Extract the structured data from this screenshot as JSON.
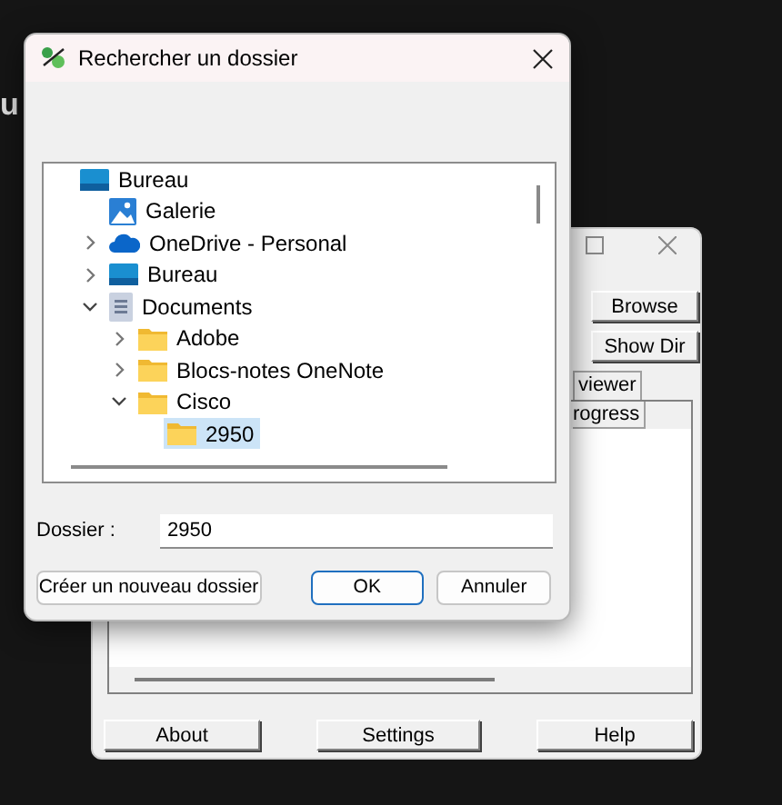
{
  "background_text": "u",
  "app_window": {
    "buttons": [
      {
        "label": "Browse"
      },
      {
        "label": "Show Dir"
      }
    ],
    "tab": "viewer",
    "column_header": "rogress",
    "footer_buttons": [
      {
        "label": "About"
      },
      {
        "label": "Settings"
      },
      {
        "label": "Help"
      }
    ]
  },
  "dialog": {
    "title": "Rechercher un dossier",
    "tree": [
      {
        "label": "Bureau",
        "kind": "desktop",
        "selected": false,
        "children": [
          {
            "label": "Galerie",
            "kind": "gallery",
            "expandable": false,
            "selected": false
          },
          {
            "label": "OneDrive - Personal",
            "kind": "cloud",
            "expandable": true,
            "expanded": false,
            "selected": false
          },
          {
            "label": "Bureau",
            "kind": "desktop",
            "expandable": true,
            "expanded": false,
            "selected": false
          },
          {
            "label": "Documents",
            "kind": "documents",
            "expandable": true,
            "expanded": true,
            "selected": false,
            "children": [
              {
                "label": "Adobe",
                "kind": "folder",
                "expandable": true,
                "expanded": false,
                "selected": false
              },
              {
                "label": "Blocs-notes OneNote",
                "kind": "folder",
                "expandable": true,
                "expanded": false,
                "selected": false
              },
              {
                "label": "Cisco",
                "kind": "folder",
                "expandable": true,
                "expanded": true,
                "selected": false,
                "children": [
                  {
                    "label": "2950",
                    "kind": "folder",
                    "expandable": false,
                    "selected": true
                  }
                ]
              }
            ]
          }
        ]
      }
    ],
    "folder_label": "Dossier :",
    "folder_value": "2950",
    "buttons": [
      {
        "label": "Créer un nouveau dossier",
        "default": false
      },
      {
        "label": "OK",
        "default": true
      },
      {
        "label": "Annuler",
        "default": false
      }
    ]
  }
}
